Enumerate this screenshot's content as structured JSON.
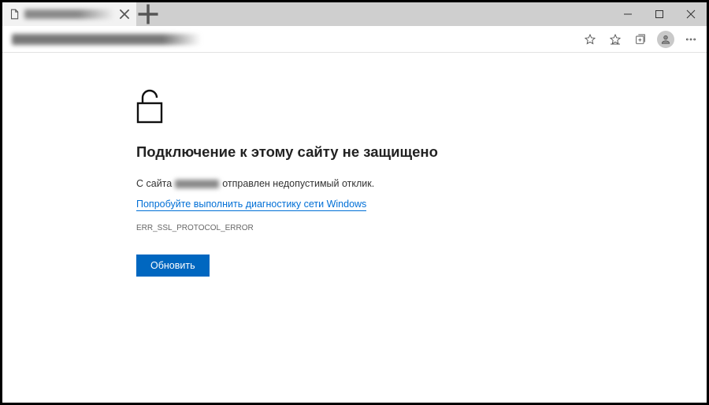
{
  "tab": {
    "title_redacted": true
  },
  "error": {
    "heading": "Подключение к этому сайту не защищено",
    "sub_prefix": "С сайта",
    "sub_suffix": "отправлен недопустимый отклик.",
    "diag_link": "Попробуйте выполнить диагностику сети Windows",
    "code": "ERR_SSL_PROTOCOL_ERROR",
    "refresh_label": "Обновить"
  }
}
